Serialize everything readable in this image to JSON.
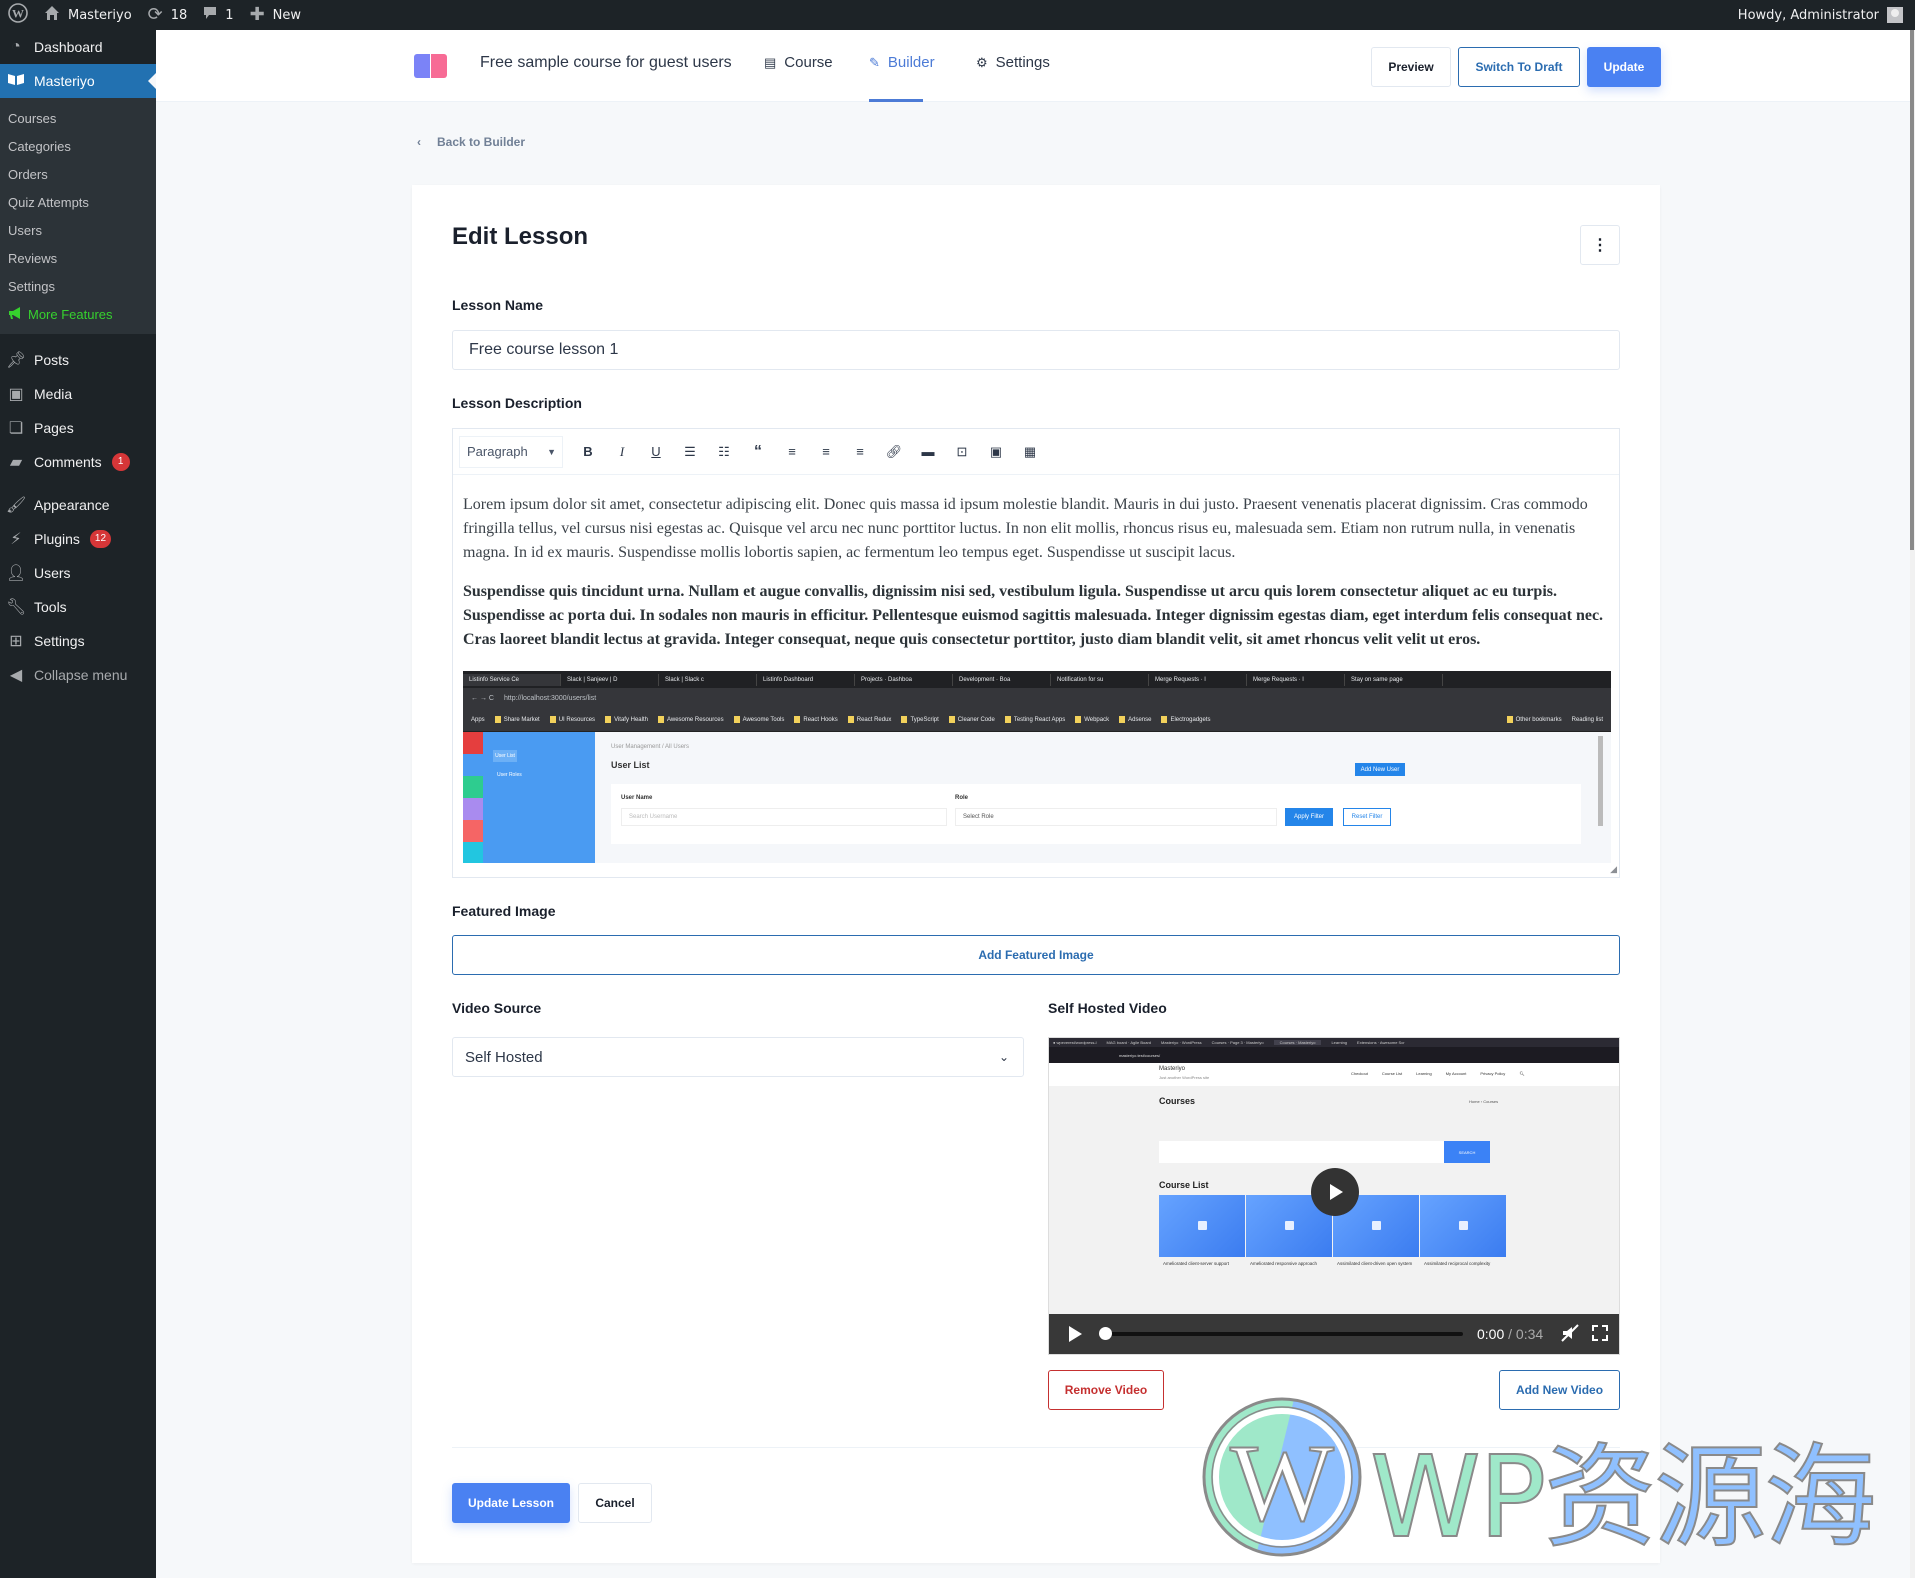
{
  "adminbar": {
    "site_name": "Masteriyo",
    "updates_count": "18",
    "comments_count": "1",
    "new_label": "New",
    "howdy": "Howdy, Administrator"
  },
  "sidebar": {
    "dashboard": "Dashboard",
    "masteriyo": "Masteriyo",
    "submenu": [
      "Courses",
      "Categories",
      "Orders",
      "Quiz Attempts",
      "Users",
      "Reviews",
      "Settings"
    ],
    "more_features": "More Features",
    "items": [
      {
        "label": "Posts",
        "icon": "pin-icon"
      },
      {
        "label": "Media",
        "icon": "media-icon"
      },
      {
        "label": "Pages",
        "icon": "pages-icon"
      },
      {
        "label": "Comments",
        "icon": "comment-icon",
        "badge": "1"
      },
      {
        "label": "Appearance",
        "icon": "brush-icon"
      },
      {
        "label": "Plugins",
        "icon": "plugin-icon",
        "badge": "12"
      },
      {
        "label": "Users",
        "icon": "user-icon"
      },
      {
        "label": "Tools",
        "icon": "wrench-icon"
      },
      {
        "label": "Settings",
        "icon": "sliders-icon"
      }
    ],
    "collapse": "Collapse menu"
  },
  "header": {
    "course_title": "Free sample course for guest users",
    "tabs": [
      {
        "label": "Course",
        "icon": "book-icon"
      },
      {
        "label": "Builder",
        "icon": "edit-icon",
        "active": true
      },
      {
        "label": "Settings",
        "icon": "gear-icon"
      }
    ],
    "preview": "Preview",
    "switch_to_draft": "Switch To Draft",
    "update": "Update"
  },
  "back_link": "Back to Builder",
  "lesson": {
    "title": "Edit Lesson",
    "name_label": "Lesson Name",
    "name_value": "Free course lesson 1",
    "description_label": "Lesson Description",
    "format_select": "Paragraph",
    "toolbar": [
      "bold",
      "italic",
      "underline",
      "bullet-list",
      "numbered-list",
      "blockquote",
      "align-left",
      "align-center",
      "align-right",
      "link",
      "horizontal-rule",
      "video",
      "media",
      "table"
    ],
    "paragraph1": "Lorem ipsum dolor sit amet, consectetur adipiscing elit. Donec quis massa id ipsum molestie blandit. Mauris in dui justo. Praesent venenatis placerat dignissim. Cras commodo fringilla tellus, vel cursus nisi egestas ac. Quisque vel arcu nec nunc porttitor luctus. In non elit mollis, rhoncus risus eu, malesuada sem. Etiam non rutrum nulla, in venenatis magna. In id ex mauris. Suspendisse mollis lobortis sapien, ac fermentum leo tempus eget. Suspendisse ut suscipit lacus.",
    "paragraph2": "Suspendisse quis tincidunt urna. Nullam et augue convallis, dignissim nisi sed, vestibulum ligula. Suspendisse ut arcu quis lorem consectetur aliquet ac eu turpis. Suspendisse ac porta dui. In sodales non mauris in efficitur. Pellentesque euismod sagittis malesuada. Integer dignissim egestas diam, eget interdum felis consequat nec. Cras laoreet blandit lectus at gravida. Integer consequat, neque quis consectetur porttitor, justo diam blandit velit, sit amet rhoncus velit velit ut eros.",
    "embedded_screenshot": {
      "tabs": [
        "Listinfo Service Ce",
        "Slack | Sanjeev | D",
        "Slack | Slack c",
        "Listinfo Dashboard",
        "Projects · Dashboa",
        "Development · Boa",
        "Notification for su",
        "Merge Requests · l",
        "Merge Requests · l",
        "Stay on same page"
      ],
      "url": "http://localhost:3000/users/list",
      "bookmarks": [
        "Apps",
        "Share Market",
        "UI Resources",
        "Vitafy Health",
        "Awesome Resources",
        "Awesome Tools",
        "React Hooks",
        "React Redux",
        "TypeScript",
        "Cleaner Code",
        "Testing React Apps",
        "Webpack",
        "Adsense",
        "Electrogadgets"
      ],
      "other_bookmarks": "Other bookmarks",
      "reading_list": "Reading list",
      "side_items": [
        "User List",
        "User Roles"
      ],
      "breadcrumb": "User Management / All Users",
      "page_title": "User List",
      "add_new_user": "Add New User",
      "user_name_label": "User Name",
      "user_name_placeholder": "Search Username",
      "role_label": "Role",
      "role_select": "Select Role",
      "apply_filter": "Apply Filter",
      "reset_filter": "Reset Filter"
    },
    "featured_image_label": "Featured Image",
    "add_featured_image": "Add Featured Image",
    "video_source_label": "Video Source",
    "video_source_value": "Self Hosted",
    "self_hosted_label": "Self Hosted Video",
    "video": {
      "site_name": "Masteriyo",
      "site_tagline": "Just another WordPress site",
      "nav": [
        "Checkout",
        "Course List",
        "Learning",
        "My Account",
        "Privacy Policy"
      ],
      "heading": "Courses",
      "breadcrumb": "Home › Courses",
      "search_button": "SEARCH",
      "course_list_heading": "Course List",
      "cards": [
        "Ameliorated client-server support",
        "Ameliorated responsive approach",
        "Assimilated client-driven open system",
        "Assimilated reciprocal complexity"
      ],
      "current_time": "0:00",
      "duration": "0:34",
      "progress_percent": 0
    },
    "remove_video": "Remove Video",
    "add_new_video": "Add New Video",
    "update_lesson": "Update Lesson",
    "cancel": "Cancel"
  },
  "watermark": {
    "latin": "WP",
    "cjk": "资源海"
  }
}
